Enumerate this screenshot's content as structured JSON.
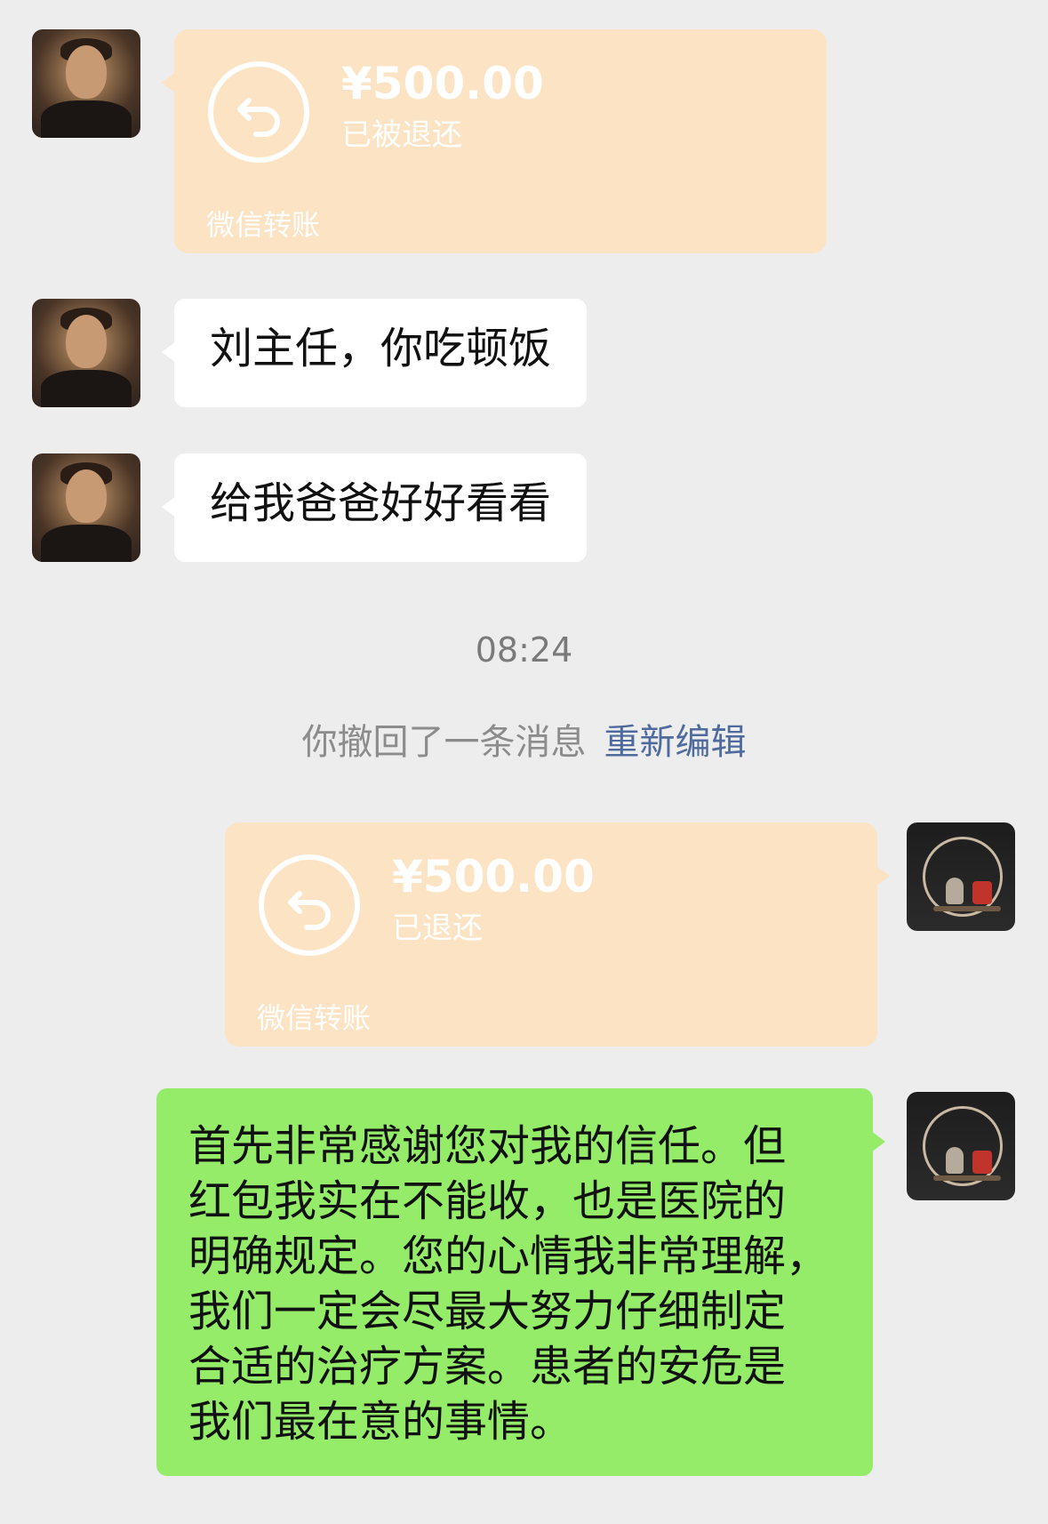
{
  "messages": {
    "transfer_1": {
      "amount": "¥500.00",
      "status": "已被退还",
      "label": "微信转账"
    },
    "text_1": "刘主任，你吃顿饭",
    "text_2": "给我爸爸好好看看",
    "timestamp": "08:24",
    "recall_notice": "你撤回了一条消息",
    "recall_action": "重新编辑",
    "transfer_2": {
      "amount": "¥500.00",
      "status": "已退还",
      "label": "微信转账"
    },
    "reply_lines": [
      "首先非常感谢您对我的信任。但",
      "红包我实在不能收，也是医院的",
      "明确规定。您的心情我非常理解，",
      "我们一定会尽最大努力仔细制定",
      "合适的治疗方案。患者的安危是",
      "我们最在意的事情。"
    ]
  },
  "colors": {
    "background": "#ededed",
    "transfer_card": "#fbe3c3",
    "sent_bubble": "#95ec69",
    "received_bubble": "#ffffff",
    "link": "#4f6a9d"
  },
  "icons": {
    "transfer_returned": "return-arrow-icon"
  }
}
